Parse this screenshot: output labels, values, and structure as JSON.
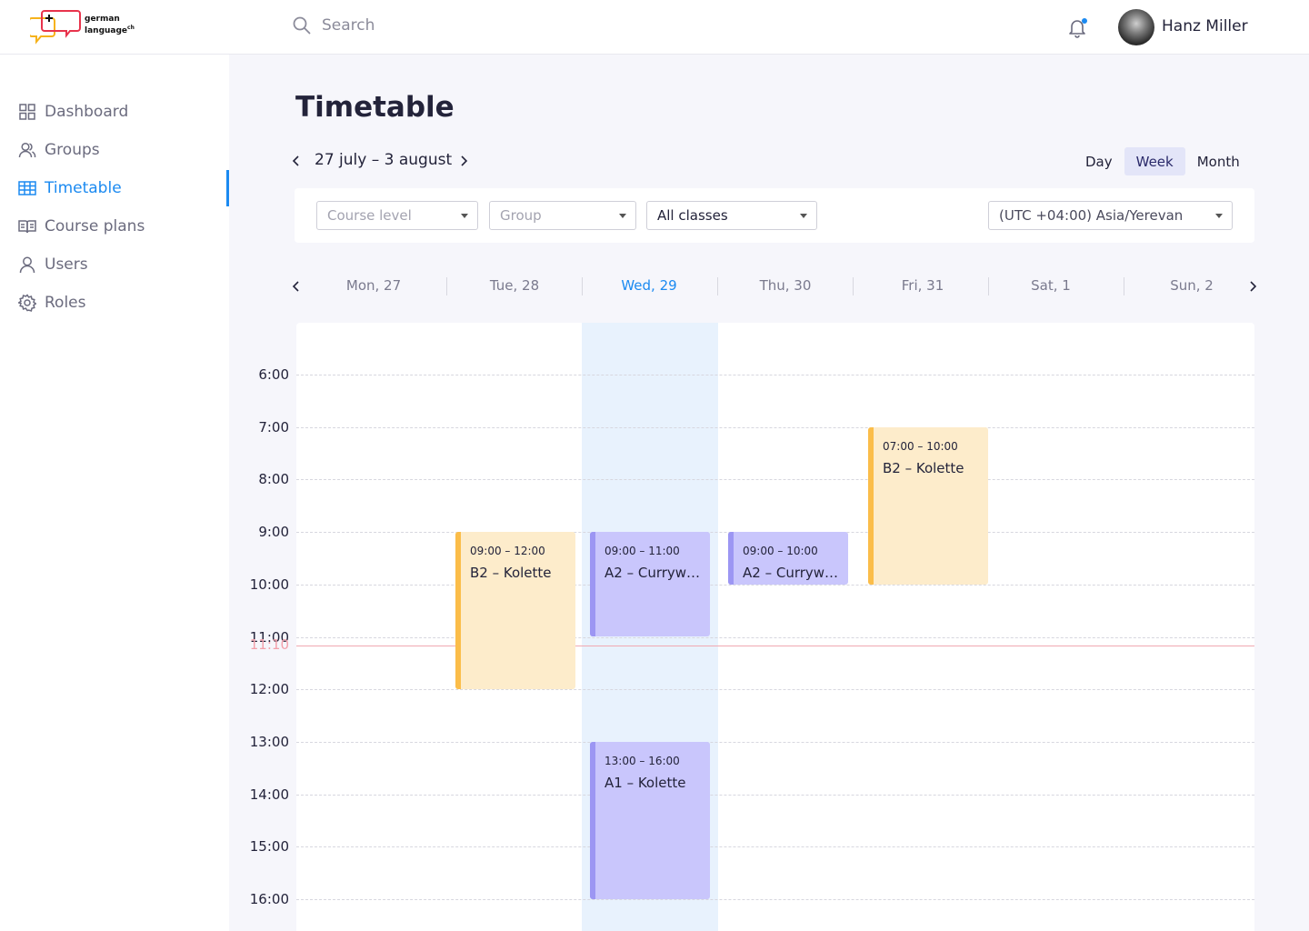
{
  "brand": {
    "line1": "german",
    "line2": "language",
    "superscript": "ch"
  },
  "search": {
    "placeholder": "Search"
  },
  "user": {
    "name": "Hanz Miller"
  },
  "sidebar": {
    "items": [
      {
        "label": "Dashboard",
        "icon": "dashboard-icon"
      },
      {
        "label": "Groups",
        "icon": "groups-icon"
      },
      {
        "label": "Timetable",
        "icon": "timetable-icon",
        "active": true
      },
      {
        "label": "Course plans",
        "icon": "course-plans-icon"
      },
      {
        "label": "Users",
        "icon": "user-icon"
      },
      {
        "label": "Roles",
        "icon": "gear-icon"
      }
    ]
  },
  "page": {
    "title": "Timetable",
    "range": "27 july – 3 august"
  },
  "views": {
    "day": "Day",
    "week": "Week",
    "month": "Month",
    "active": "Week"
  },
  "filters": {
    "course_level": "Course level",
    "group": "Group",
    "classes": "All classes",
    "timezone": "(UTC +04:00) Asia/Yerevan"
  },
  "days": [
    "Mon, 27",
    "Tue, 28",
    "Wed, 29",
    "Thu, 30",
    "Fri, 31",
    "Sat, 1",
    "Sun, 2"
  ],
  "today": "Wed, 29",
  "hours": [
    "6:00",
    "7:00",
    "8:00",
    "9:00",
    "10:00",
    "11:00",
    "12:00",
    "13:00",
    "14:00",
    "15:00",
    "16:00"
  ],
  "now": "11:10",
  "events": [
    {
      "day": "Tue, 28",
      "time": "09:00 – 12:00",
      "title": "B2 – Kolette",
      "color": "yellow"
    },
    {
      "day": "Wed, 29",
      "time": "09:00 – 11:00",
      "title": "A2 – Currywu...",
      "color": "purple"
    },
    {
      "day": "Wed, 29",
      "time": "13:00 – 16:00",
      "title": "A1 – Kolette",
      "color": "purple"
    },
    {
      "day": "Thu, 30",
      "time": "09:00 – 10:00",
      "title": "A2 – Currywu...",
      "color": "purple"
    },
    {
      "day": "Fri, 31",
      "time": "07:00 – 10:00",
      "title": "B2 – Kolette",
      "color": "yellow"
    }
  ],
  "colors": {
    "accent": "#1b8af1",
    "yellow_bar": "#fbbd49",
    "yellow_bg": "#fdeccb",
    "purple_bar": "#9c96f3",
    "purple_bg": "#c9c6fc",
    "now_line": "#f1a9b2"
  }
}
